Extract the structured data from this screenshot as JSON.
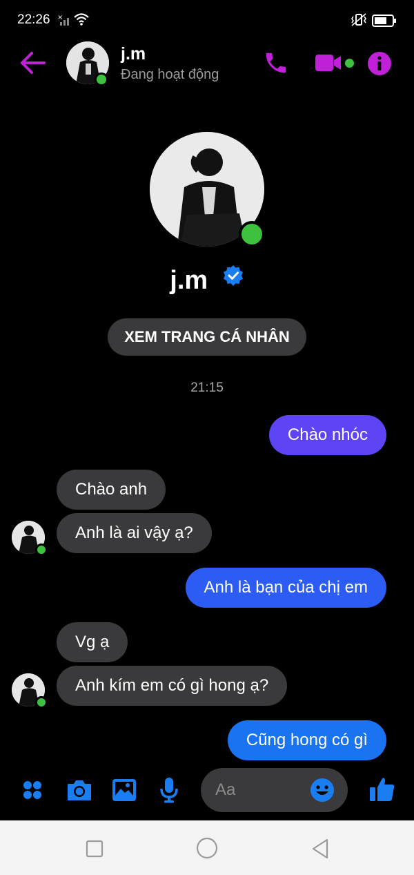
{
  "status_bar": {
    "time": "22:26"
  },
  "header": {
    "name": "j.m",
    "status": "Đang hoạt động"
  },
  "profile": {
    "name": "j.m",
    "button_label": "XEM TRANG CÁ NHÂN"
  },
  "messages": {
    "timestamp": "21:15",
    "list": [
      {
        "side": "out",
        "text": "Chào nhóc"
      },
      {
        "side": "in",
        "text": "Chào anh"
      },
      {
        "side": "in",
        "text": "Anh là ai vậy ạ?"
      },
      {
        "side": "out",
        "text": "Anh là bạn của chị em"
      },
      {
        "side": "in",
        "text": "Vg ạ"
      },
      {
        "side": "in",
        "text": "Anh kím em có gì hong ạ?"
      },
      {
        "side": "out",
        "text": "Cũng hong có gì"
      }
    ]
  },
  "composer": {
    "placeholder": "Aa"
  },
  "colors": {
    "accent": "#c020d8",
    "blue": "#1a7df2",
    "online": "#3ec13e",
    "bubble_in": "#3a3a3c"
  }
}
